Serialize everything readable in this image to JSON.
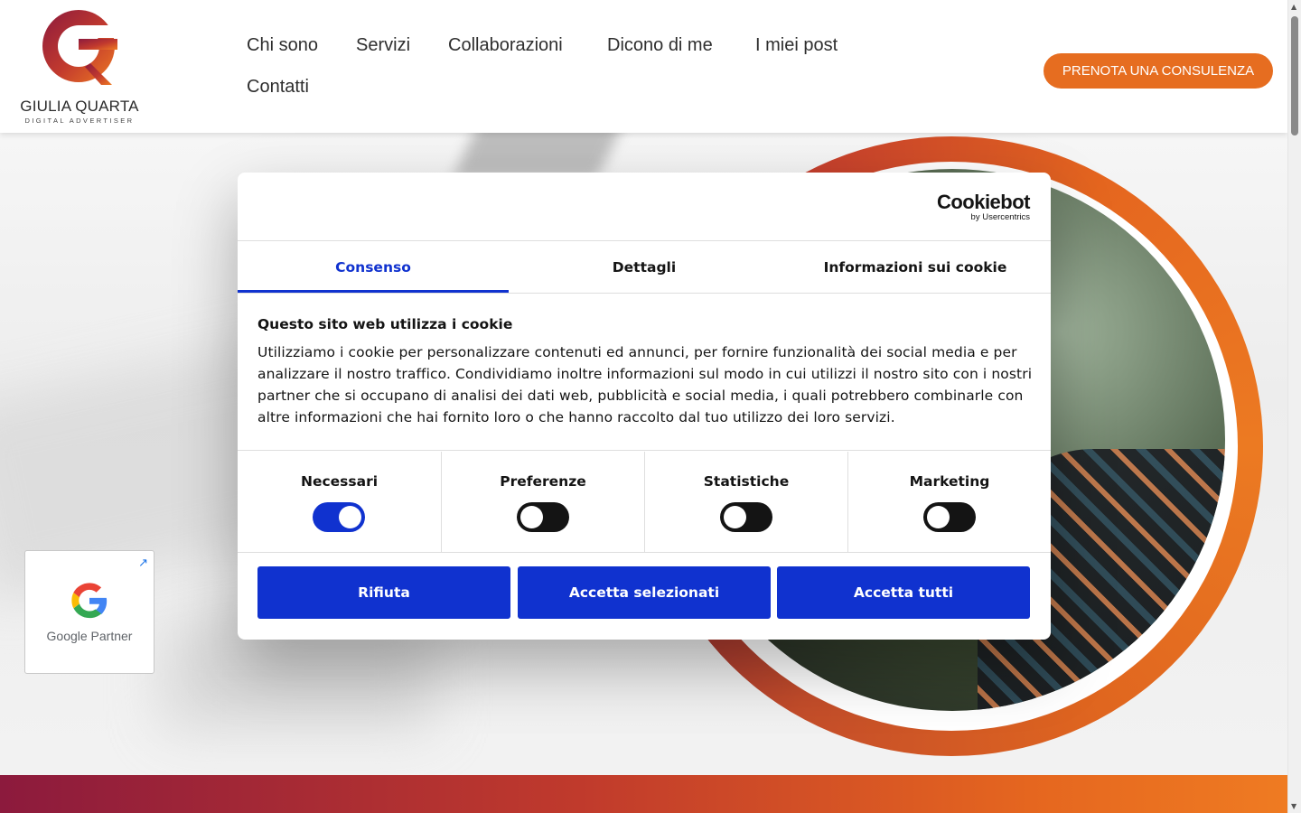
{
  "brand": {
    "name": "GIULIA QUARTA",
    "tagline": "DIGITAL ADVERTISER",
    "colors": {
      "orange": "#e66d20",
      "burgundy": "#8c1a3d"
    }
  },
  "nav": {
    "items": [
      "Chi sono",
      "Servizi",
      "Collaborazioni",
      "Dicono di me",
      "I miei post",
      "Contatti"
    ],
    "cta": "PRENOTA UNA CONSULENZA"
  },
  "google_partner": {
    "label": "Google Partner",
    "icon": "external-link-icon"
  },
  "cookie_dialog": {
    "logo": {
      "main": "Cookiebot",
      "sub": "by Usercentrics"
    },
    "tabs": [
      "Consenso",
      "Dettagli",
      "Informazioni sui cookie"
    ],
    "active_tab": "Consenso",
    "title": "Questo sito web utilizza i cookie",
    "body": "Utilizziamo i cookie per personalizzare contenuti ed annunci, per fornire funzionalità dei social media e per analizzare il nostro traffico. Condividiamo inoltre informazioni sul modo in cui utilizzi il nostro sito con i nostri partner che si occupano di analisi dei dati web, pubblicità e social media, i quali potrebbero combinarle con altre informazioni che hai fornito loro o che hanno raccolto dal tuo utilizzo dei loro servizi.",
    "categories": [
      {
        "label": "Necessari",
        "checked": true
      },
      {
        "label": "Preferenze",
        "checked": false
      },
      {
        "label": "Statistiche",
        "checked": false
      },
      {
        "label": "Marketing",
        "checked": false
      }
    ],
    "buttons": {
      "reject": "Rifiuta",
      "accept_selected": "Accetta selezionati",
      "accept_all": "Accetta tutti"
    },
    "accent_color": "#1032cf"
  }
}
